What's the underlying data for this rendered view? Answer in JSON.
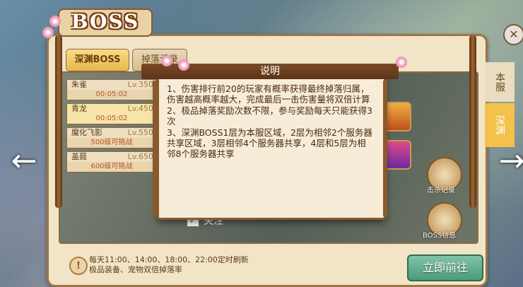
{
  "title": "BOSS",
  "tabs": [
    "深渊BOSS",
    "掉落记录"
  ],
  "side_tabs": [
    "本服",
    "深渊"
  ],
  "bosses": [
    {
      "name": "朱雀",
      "level": "Lv.350",
      "status": "00:05:02"
    },
    {
      "name": "青龙",
      "level": "Lv.450",
      "status": "00:05:02"
    },
    {
      "name": "魔化飞影",
      "level": "Lv.550",
      "status": "500级可挑战"
    },
    {
      "name": "盖聂",
      "level": "Lv.650",
      "status": "600级可挑战"
    }
  ],
  "follow_label": "关注",
  "right_actions": {
    "kill_record": "击杀记录",
    "boss_info": "BOSS信息"
  },
  "footer": {
    "line1": "每天11:00、14:00、18:00、22:00定时刷新",
    "line2": "极品装备、宠物双倍掉落率"
  },
  "go_button": "立即前往",
  "popup": {
    "title": "说明",
    "lines": [
      "1、伤害排行前20的玩家有概率获得最终掉落归属，伤害越高概率越大，完成最后一击伤害量将双倍计算",
      "2、极品掉落奖励次数不限，参与奖励每天只能获得3次",
      "3、深渊BOSS1层为本服区域，2层为相邻2个服务器共享区域，3层相邻4个服务器共享，4层和5层为相邻8个服务器共享"
    ]
  },
  "icons": {
    "close": "close-icon",
    "left": "arrow-left-icon",
    "right": "arrow-right-icon",
    "notice": "exclamation-icon"
  }
}
